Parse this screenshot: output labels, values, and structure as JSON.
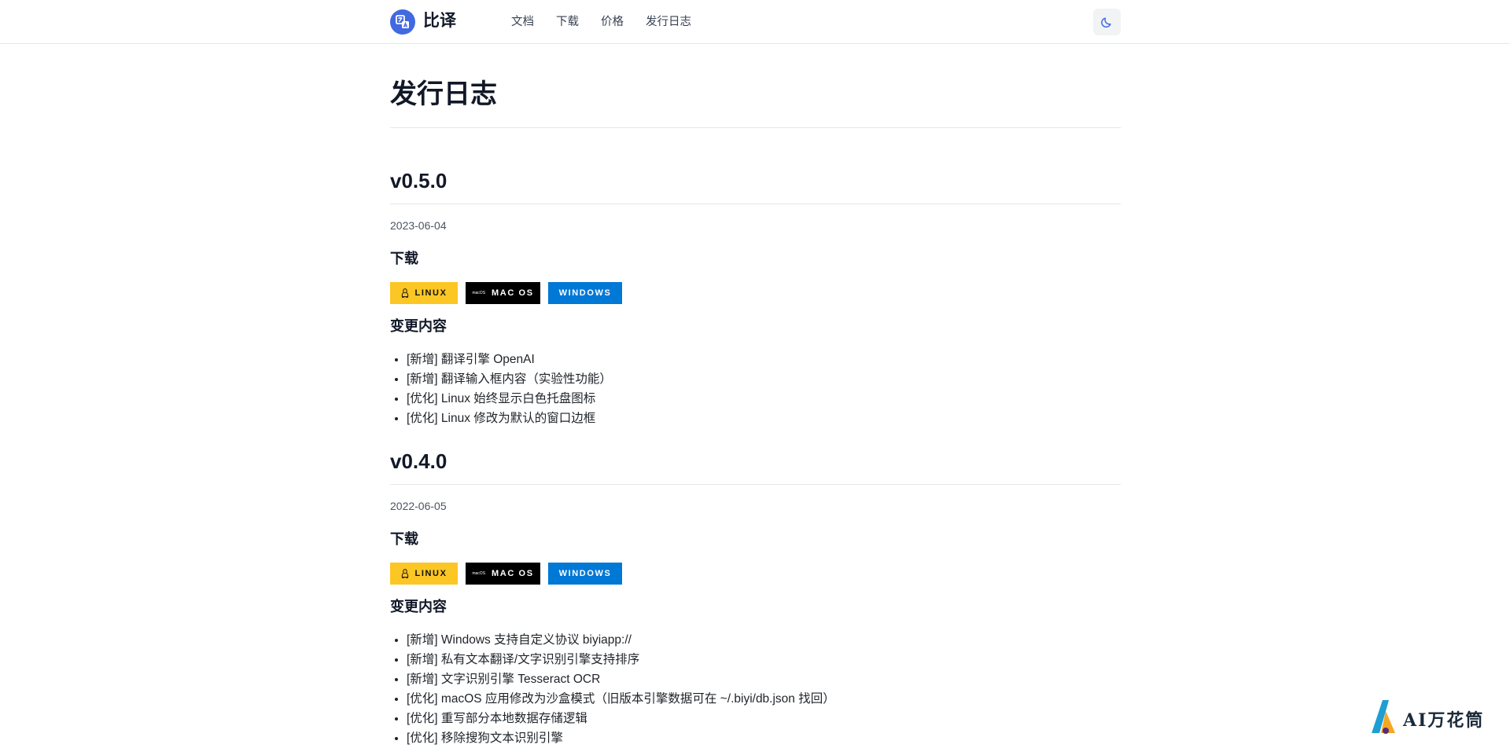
{
  "header": {
    "brand": "比译",
    "nav": [
      {
        "label": "文档"
      },
      {
        "label": "下载"
      },
      {
        "label": "价格"
      },
      {
        "label": "发行日志"
      }
    ],
    "theme_icon": "moon-icon",
    "logo_icon": "translate-icon"
  },
  "page": {
    "title": "发行日志"
  },
  "releases": [
    {
      "version": "v0.5.0",
      "date": "2023-06-04",
      "download_heading": "下载",
      "badges": {
        "linux": "LINUX",
        "mac": "MAC OS",
        "mac_mini": "macOS",
        "windows": "WINDOWS"
      },
      "changes_heading": "变更内容",
      "changes": [
        "[新增] 翻译引擎 OpenAI",
        "[新增] 翻译输入框内容（实验性功能）",
        "[优化] Linux 始终显示白色托盘图标",
        "[优化] Linux 修改为默认的窗口边框"
      ]
    },
    {
      "version": "v0.4.0",
      "date": "2022-06-05",
      "download_heading": "下载",
      "badges": {
        "linux": "LINUX",
        "mac": "MAC OS",
        "mac_mini": "macOS",
        "windows": "WINDOWS"
      },
      "changes_heading": "变更内容",
      "changes": [
        "[新增] Windows 支持自定义协议 biyiapp://",
        "[新增] 私有文本翻译/文字识别引擎支持排序",
        "[新增] 文字识别引擎 Tesseract OCR",
        "[优化] macOS 应用修改为沙盒模式（旧版本引擎数据可在 ~/.biyi/db.json 找回）",
        "[优化] 重写部分本地数据存储逻辑",
        "[优化] 移除搜狗文本识别引擎"
      ]
    }
  ],
  "watermark": {
    "text": "AI万花筒"
  },
  "colors": {
    "accent": "#4169e1",
    "linux_badge": "#fcc624",
    "mac_badge": "#000000",
    "windows_badge": "#0078d6"
  }
}
